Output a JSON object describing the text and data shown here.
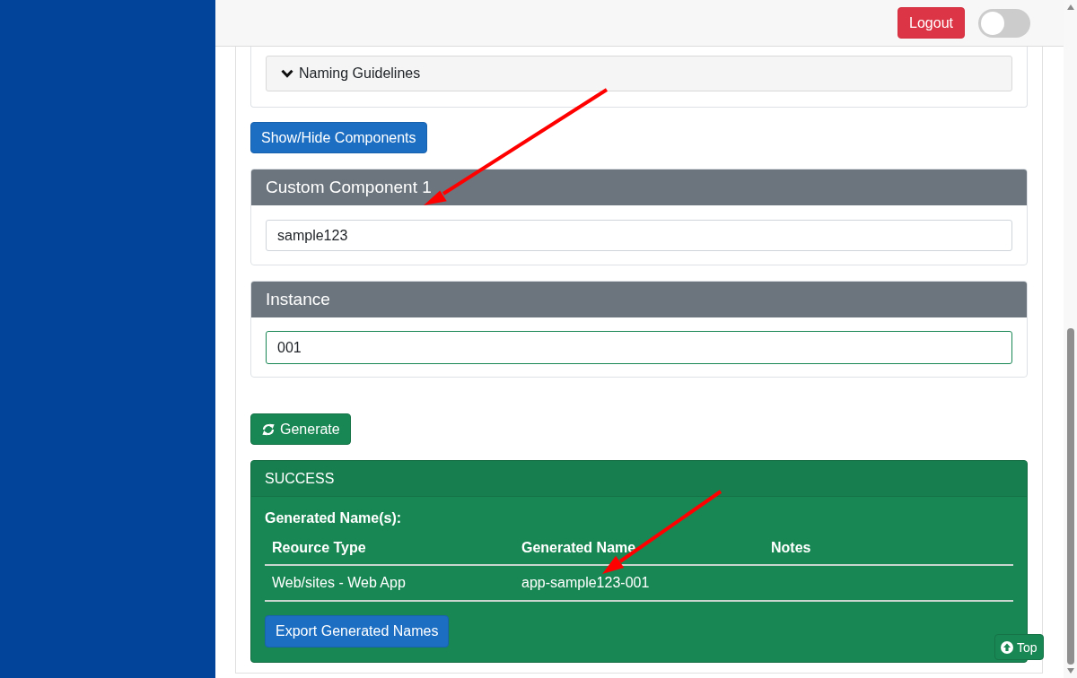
{
  "header": {
    "logout_button": "Logout",
    "toggle": {
      "on": false
    }
  },
  "guidelines": {
    "label": "Naming Guidelines",
    "expanded": false
  },
  "toggle_components_button": "Show/Hide Components",
  "components": [
    {
      "title": "Custom Component 1",
      "value": "sample123",
      "valid": false
    },
    {
      "title": "Instance",
      "value": "001",
      "valid": true
    }
  ],
  "generate_button": "Generate",
  "result": {
    "status": "SUCCESS",
    "heading": "Generated Name(s):",
    "columns": [
      "Reource Type",
      "Generated Name",
      "Notes"
    ],
    "rows": [
      [
        "Web/sites - Web App",
        "app-sample123-001"
      ]
    ],
    "export_button": "Export Generated Names"
  },
  "top_button": "Top"
}
